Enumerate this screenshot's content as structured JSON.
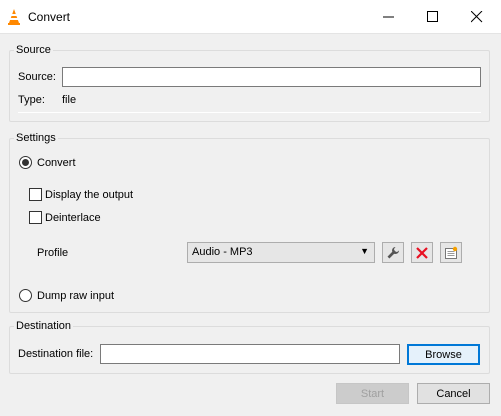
{
  "window": {
    "title": "Convert",
    "controls": {
      "minimize": "—",
      "maximize": "☐",
      "close": "✕"
    }
  },
  "source_group": {
    "title": "Source",
    "source_label": "Source:",
    "source_value": "",
    "type_label": "Type:",
    "type_value": "file"
  },
  "settings_group": {
    "title": "Settings",
    "convert_label": "Convert",
    "convert_selected": true,
    "display_output_label": "Display the output",
    "deinterlace_label": "Deinterlace",
    "profile_label": "Profile",
    "profile_value": "Audio - MP3",
    "dump_raw_label": "Dump raw input"
  },
  "destination_group": {
    "title": "Destination",
    "file_label": "Destination file:",
    "file_value": "",
    "browse_label": "Browse"
  },
  "footer": {
    "start_label": "Start",
    "cancel_label": "Cancel"
  },
  "icons": {
    "app": "vlc-cone-icon",
    "edit_profile": "wrench-icon",
    "delete_profile": "red-x-icon",
    "new_profile": "new-profile-icon"
  },
  "colors": {
    "accent": "#0078d7",
    "delete": "#e81123",
    "vlc_orange": "#ff8800"
  }
}
